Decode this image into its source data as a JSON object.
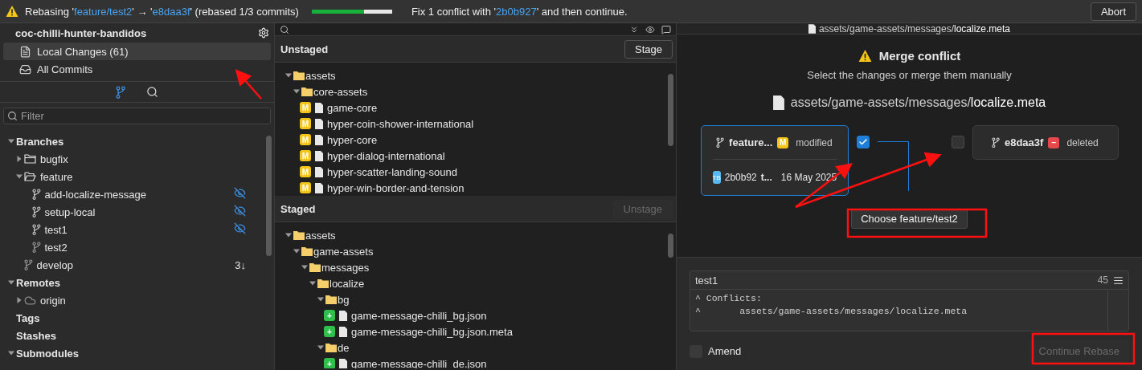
{
  "banner": {
    "segments": [
      {
        "kind": "text",
        "text": "Rebasing '"
      },
      {
        "kind": "link",
        "text": "feature/test2"
      },
      {
        "kind": "text",
        "text": "' → '"
      },
      {
        "kind": "link",
        "text": "e8daa3f"
      },
      {
        "kind": "text",
        "text": "' (rebased 1/3 commits)"
      }
    ],
    "progress": {
      "level": 0.65
    },
    "hint": [
      {
        "kind": "text",
        "text": "Fix 1 conflict with '"
      },
      {
        "kind": "link",
        "text": "2b0b927"
      },
      {
        "kind": "text",
        "text": "' and then continue."
      }
    ],
    "abort": "Abort"
  },
  "sidebar": {
    "repo": "coc-chilli-hunter-bandidos",
    "views": [
      {
        "label": "Local Changes (61)",
        "kind": "changes",
        "selected": true
      },
      {
        "label": "All Commits",
        "kind": "commits",
        "selected": false
      }
    ],
    "tabs": [
      {
        "kind": "branches",
        "selected": true
      },
      {
        "kind": "search",
        "selected": false
      }
    ],
    "filter": {
      "placeholder": "Filter"
    },
    "tree": [
      {
        "label": "Branches",
        "kind": "section",
        "expanded": true,
        "children": [
          {
            "label": "bugfix",
            "kind": "folder",
            "expanded": false
          },
          {
            "label": "feature",
            "kind": "folder",
            "expanded": true,
            "children": [
              {
                "label": "add-localize-message",
                "kind": "branch",
                "hidden": true
              },
              {
                "label": "setup-local",
                "kind": "branch",
                "hidden": true
              },
              {
                "label": "test1",
                "kind": "branch",
                "hidden": true
              },
              {
                "label": "test2",
                "kind": "branch",
                "hidden": false
              }
            ]
          },
          {
            "label": "develop",
            "kind": "branch",
            "hidden": false,
            "badge": "3↓"
          }
        ]
      },
      {
        "label": "Remotes",
        "kind": "section",
        "expanded": true,
        "children": [
          {
            "label": "origin",
            "kind": "remote",
            "expanded": false
          }
        ]
      },
      {
        "label": "Tags",
        "kind": "section"
      },
      {
        "label": "Stashes",
        "kind": "section"
      },
      {
        "label": "Submodules",
        "kind": "section",
        "expanded": true
      }
    ]
  },
  "changes": {
    "unstaged": {
      "title": "Unstaged",
      "button": {
        "label": "Stage",
        "disabled": false
      },
      "tree": [
        {
          "label": "assets",
          "kind": "folder",
          "expanded": true,
          "children": [
            {
              "label": "core-assets",
              "kind": "folder",
              "expanded": true,
              "children": [
                {
                  "label": "game-core",
                  "kind": "file",
                  "color": "#f5c518",
                  "badge": "M"
                },
                {
                  "label": "hyper-coin-shower-international",
                  "kind": "file",
                  "color": "#f5c518",
                  "badge": "M"
                },
                {
                  "label": "hyper-core",
                  "kind": "file",
                  "color": "#f5c518",
                  "badge": "M"
                },
                {
                  "label": "hyper-dialog-international",
                  "kind": "file",
                  "color": "#f5c518",
                  "badge": "M"
                },
                {
                  "label": "hyper-scatter-landing-sound",
                  "kind": "file",
                  "color": "#f5c518",
                  "badge": "M"
                },
                {
                  "label": "hyper-win-border-and-tension",
                  "kind": "file",
                  "color": "#f5c518",
                  "badge": "M"
                }
              ]
            }
          ]
        }
      ]
    },
    "staged": {
      "title": "Staged",
      "button": {
        "label": "Unstage",
        "disabled": true
      },
      "tree": [
        {
          "label": "assets",
          "kind": "folder",
          "expanded": true,
          "children": [
            {
              "label": "game-assets",
              "kind": "folder",
              "expanded": true,
              "children": [
                {
                  "label": "messages",
                  "kind": "folder",
                  "expanded": true,
                  "children": [
                    {
                      "label": "localize",
                      "kind": "folder",
                      "expanded": true,
                      "children": [
                        {
                          "label": "bg",
                          "kind": "folder",
                          "expanded": true,
                          "children": [
                            {
                              "label": "game-message-chilli_bg.json",
                              "kind": "file",
                              "color": "#2fbf4a",
                              "badge": "+"
                            },
                            {
                              "label": "game-message-chilli_bg.json.meta",
                              "kind": "file",
                              "color": "#2fbf4a",
                              "badge": "+"
                            }
                          ]
                        },
                        {
                          "label": "de",
                          "kind": "folder",
                          "expanded": true,
                          "children": [
                            {
                              "label": "game-message-chilli_de.json",
                              "kind": "file",
                              "color": "#2fbf4a",
                              "badge": "+"
                            }
                          ]
                        }
                      ]
                    }
                  ]
                }
              ]
            }
          ]
        }
      ]
    }
  },
  "conflict": {
    "header_dir": "assets/game-assets/messages/",
    "header_name": "localize.meta",
    "file_dir": "assets/game-assets/messages/",
    "file_name": "localize.meta",
    "title": "Merge conflict",
    "subtitle": "Select the changes or merge them manually",
    "sides": [
      {
        "branch": "feature...",
        "color": "#f5c518",
        "badge": "M",
        "label": "modified",
        "checked": true,
        "commit": {
          "avatar": "TB",
          "hash": "2b0b92",
          "author": "t...",
          "date": "16 May 2025"
        }
      },
      {
        "branch": "e8daa3f",
        "color": "#e5484d",
        "badge": "−",
        "label": "deleted",
        "checked": false
      }
    ],
    "choose": "Choose feature/test2"
  },
  "commit": {
    "subject": "test1",
    "count": "45",
    "body": [
      "^ Conflicts:",
      "^       assets/game-assets/messages/localize.meta"
    ],
    "amend": {
      "label": "Amend",
      "checked": false
    },
    "continue": {
      "label": "Continue Rebase",
      "disabled": true
    }
  }
}
